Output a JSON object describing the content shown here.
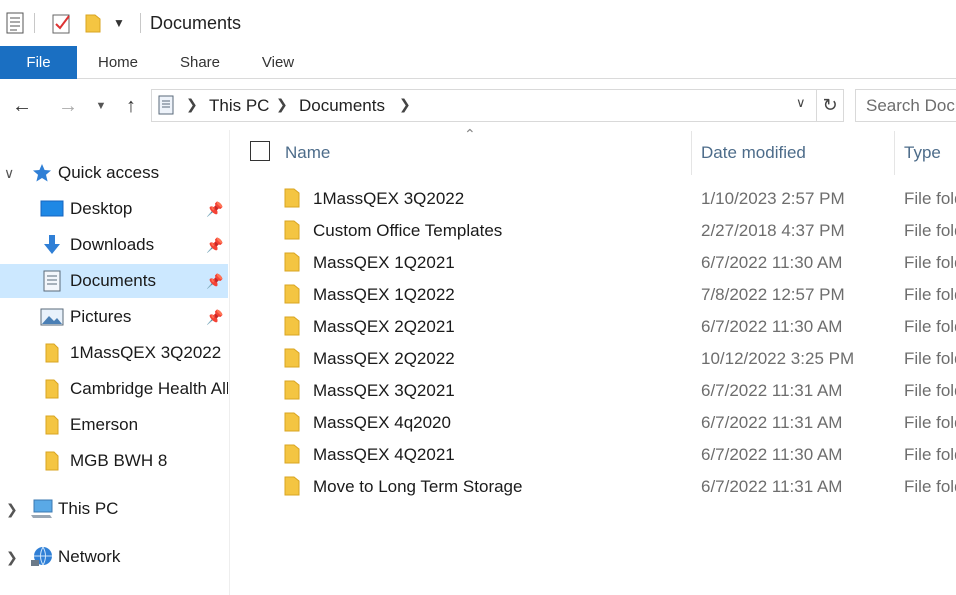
{
  "window": {
    "title": "Documents"
  },
  "colors": {
    "accent": "#1a6fc2",
    "selected": "#cce8ff",
    "folder": "#f4c542",
    "header_text": "#4d6c8a"
  },
  "ribbon": {
    "tabs": [
      {
        "label": "File"
      },
      {
        "label": "Home"
      },
      {
        "label": "Share"
      },
      {
        "label": "View"
      }
    ]
  },
  "address": {
    "breadcrumbs": [
      {
        "label": "This PC"
      },
      {
        "label": "Documents"
      }
    ],
    "search_placeholder": "Search Documents"
  },
  "nav": {
    "quick_access_label": "Quick access",
    "pinned": [
      {
        "label": "Desktop",
        "icon": "desktop-icon"
      },
      {
        "label": "Downloads",
        "icon": "download-arrow-icon"
      },
      {
        "label": "Documents",
        "icon": "documents-icon",
        "selected": true
      },
      {
        "label": "Pictures",
        "icon": "pictures-icon"
      }
    ],
    "recent": [
      {
        "label": "1MassQEX 3Q2022"
      },
      {
        "label": "Cambridge Health Alliance"
      },
      {
        "label": "Emerson"
      },
      {
        "label": "MGB BWH 8"
      }
    ],
    "this_pc_label": "This PC",
    "network_label": "Network"
  },
  "list": {
    "columns": {
      "name": "Name",
      "date": "Date modified",
      "type": "Type"
    },
    "rows": [
      {
        "name": "1MassQEX 3Q2022",
        "date": "1/10/2023 2:57 PM",
        "type": "File folder"
      },
      {
        "name": "Custom Office Templates",
        "date": "2/27/2018 4:37 PM",
        "type": "File folder"
      },
      {
        "name": "MassQEX 1Q2021",
        "date": "6/7/2022 11:30 AM",
        "type": "File folder"
      },
      {
        "name": "MassQEX 1Q2022",
        "date": "7/8/2022 12:57 PM",
        "type": "File folder"
      },
      {
        "name": "MassQEX 2Q2021",
        "date": "6/7/2022 11:30 AM",
        "type": "File folder"
      },
      {
        "name": "MassQEX 2Q2022",
        "date": "10/12/2022 3:25 PM",
        "type": "File folder"
      },
      {
        "name": "MassQEX 3Q2021",
        "date": "6/7/2022 11:31 AM",
        "type": "File folder"
      },
      {
        "name": "MassQEX 4q2020",
        "date": "6/7/2022 11:31 AM",
        "type": "File folder"
      },
      {
        "name": "MassQEX 4Q2021",
        "date": "6/7/2022 11:30 AM",
        "type": "File folder"
      },
      {
        "name": "Move to Long Term Storage",
        "date": "6/7/2022 11:31 AM",
        "type": "File folder"
      }
    ]
  }
}
